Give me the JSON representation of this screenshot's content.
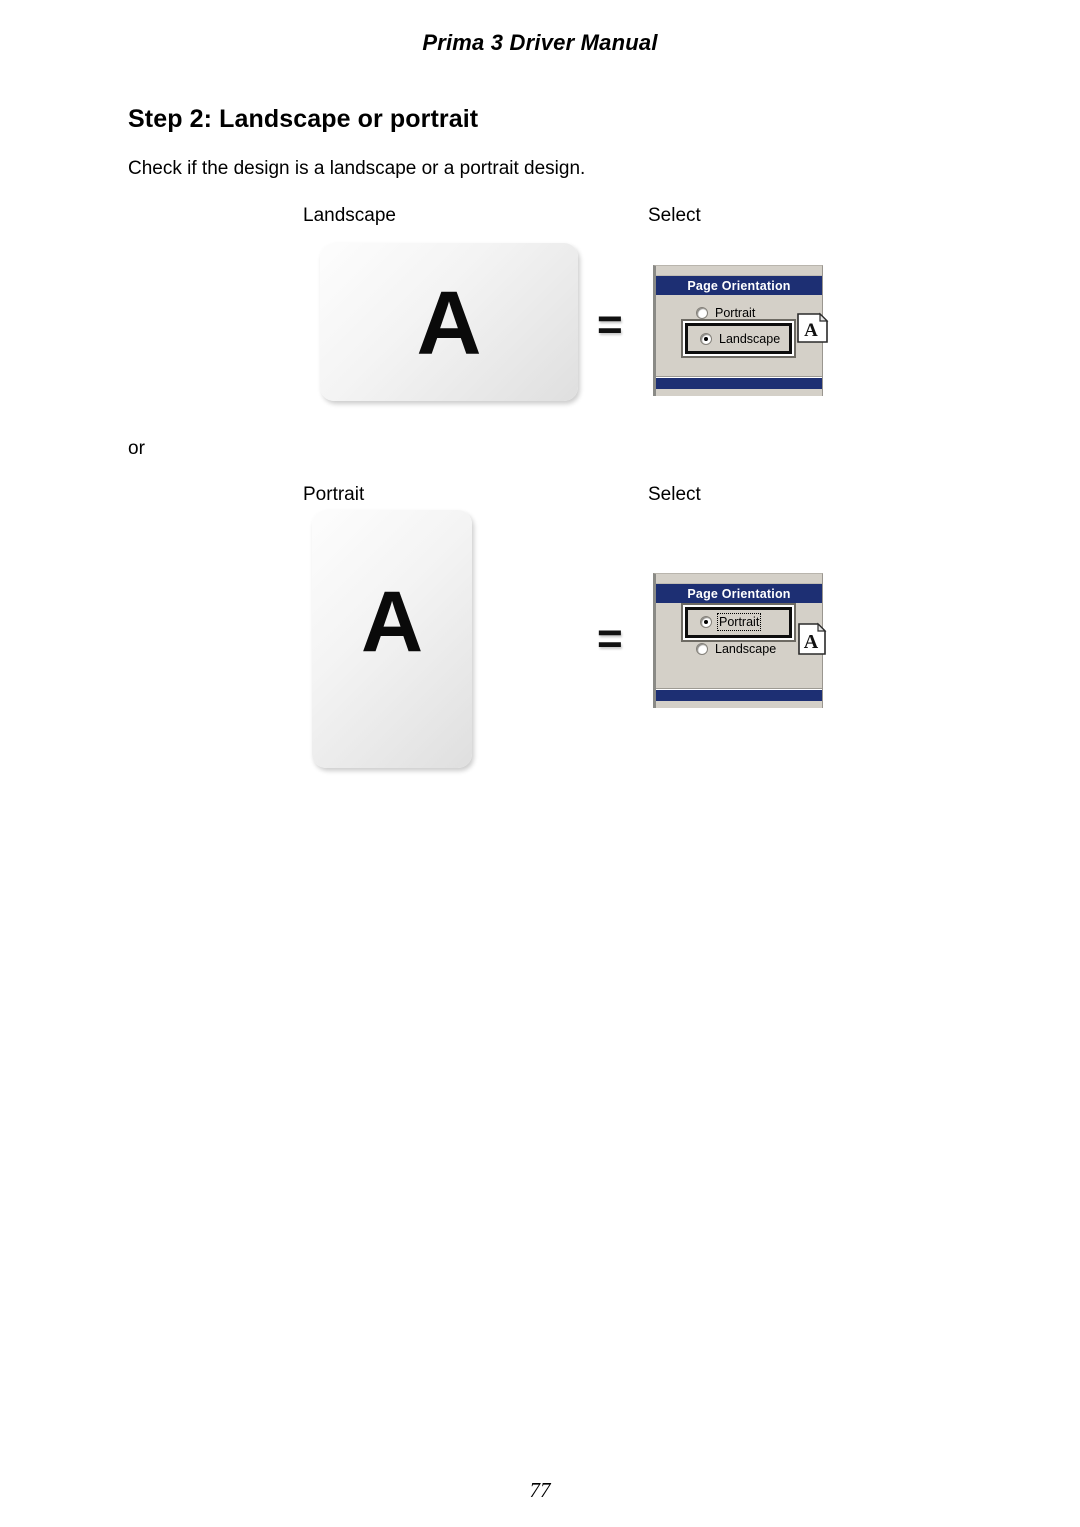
{
  "header": {
    "title": "Prima 3 Driver Manual"
  },
  "content": {
    "step_heading": "Step 2: Landscape or portrait",
    "intro_text": "Check if the design is a landscape or a portrait design.",
    "or_text": "or"
  },
  "rows": [
    {
      "orientation_label": "Landscape",
      "select_label": "Select",
      "card_glyph": "A",
      "equals_sign": "="
    },
    {
      "orientation_label": "Portrait",
      "select_label": "Select",
      "card_glyph": "A",
      "equals_sign": "="
    }
  ],
  "dialogs": [
    {
      "title": "Page Orientation",
      "options": [
        {
          "label": "Portrait",
          "selected": false,
          "focused": false
        },
        {
          "label": "Landscape",
          "selected": true,
          "focused": false
        }
      ],
      "preview_icon": "page-landscape-icon",
      "preview_glyph": "A",
      "highlighted_option": "Landscape"
    },
    {
      "title": "Page Orientation",
      "options": [
        {
          "label": "Portrait",
          "selected": true,
          "focused": true
        },
        {
          "label": "Landscape",
          "selected": false,
          "focused": false
        }
      ],
      "preview_icon": "page-portrait-icon",
      "preview_glyph": "A",
      "highlighted_option": "Portrait"
    }
  ],
  "footer": {
    "page_number": "77"
  },
  "colors": {
    "titlebar_navy": "#1d2f73",
    "dialog_face": "#d4d0c8",
    "text": "#000000",
    "page_background": "#ffffff"
  }
}
